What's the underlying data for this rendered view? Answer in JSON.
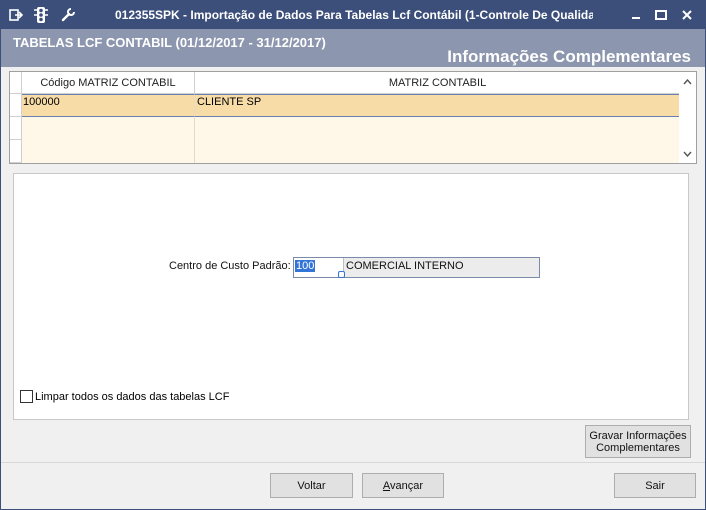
{
  "window": {
    "title": "012355SPK - Importação de Dados Para Tabelas Lcf Contábil (1-Controle De Qualidad",
    "icons": [
      "exit-icon",
      "traffic-light-icon",
      "wrench-icon"
    ],
    "controls": [
      "minimize",
      "maximize",
      "close"
    ]
  },
  "header": {
    "left_title": "TABELAS LCF CONTABIL (01/12/2017 - 31/12/2017)",
    "right_title": "Informações Complementares"
  },
  "grid": {
    "columns": [
      "Código MATRIZ CONTABIL",
      "MATRIZ CONTABIL"
    ],
    "rows": [
      {
        "codigo": "100000",
        "matriz": "CLIENTE SP"
      }
    ]
  },
  "form": {
    "centro_custo_label": "Centro de Custo Padrão:",
    "centro_custo_code": "100",
    "centro_custo_desc": "COMERCIAL INTERNO",
    "clear_checkbox_label": "Limpar todos os dados das tabelas LCF",
    "clear_checkbox_checked": false
  },
  "buttons": {
    "gravar_line1": "Gravar Informações",
    "gravar_line2": "Complementares",
    "voltar": "Voltar",
    "avancar_mnemonic": "A",
    "avancar_rest": "vançar",
    "sair": "Sair"
  },
  "colors": {
    "titlebar": "#3c4f7a",
    "header_band": "#8c96ae",
    "selected_row": "#f7dca8",
    "empty_row": "#fff8e8",
    "selection": "#3375d6"
  }
}
